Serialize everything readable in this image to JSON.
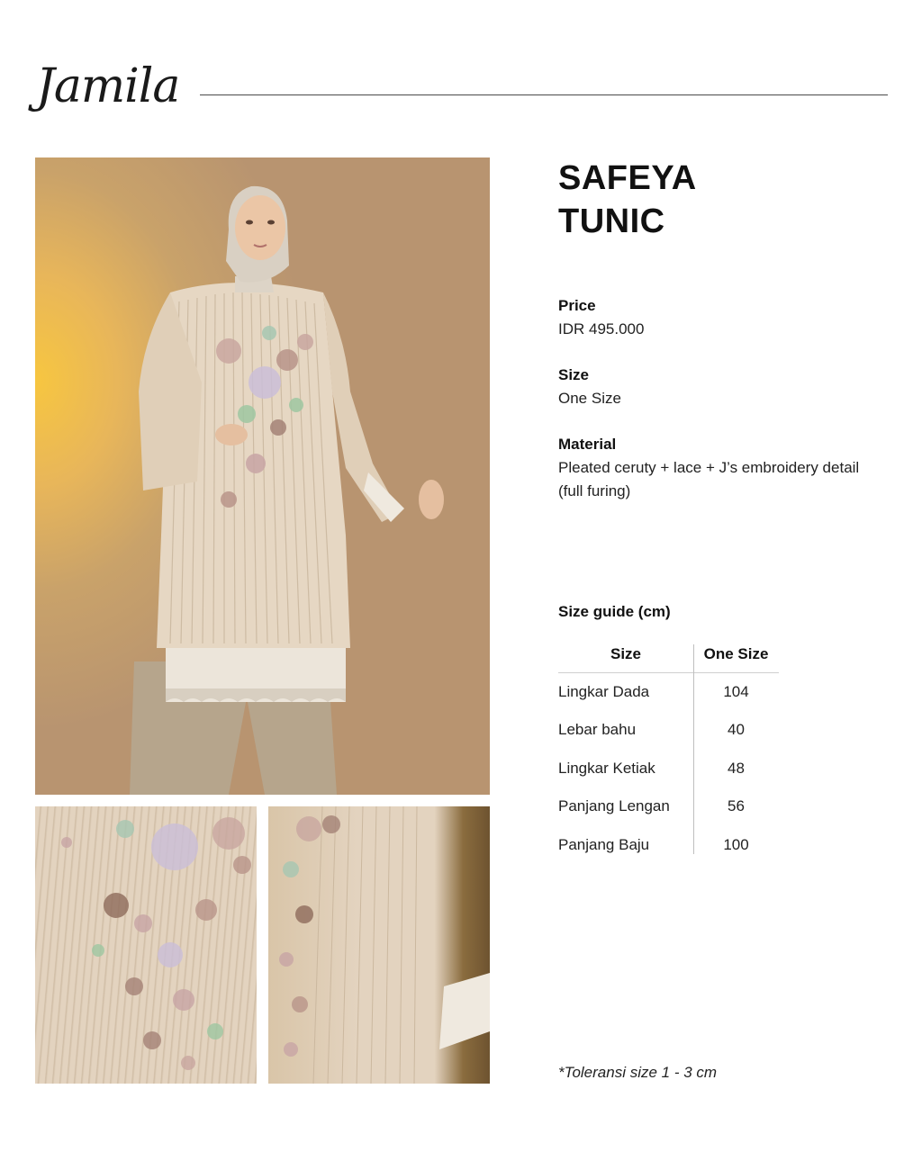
{
  "brand": "Jamila",
  "product": {
    "title_line1": "SAFEYA",
    "title_line2": "TUNIC"
  },
  "details": {
    "price_label": "Price",
    "price_value": "IDR 495.000",
    "size_label": "Size",
    "size_value": "One Size",
    "material_label": "Material",
    "material_value_line1": "Pleated ceruty + lace + J’s embroidery detail",
    "material_value_line2": "(full furing)"
  },
  "size_guide": {
    "title": "Size guide (cm)",
    "headers": [
      "Size",
      "One Size"
    ],
    "rows": [
      {
        "name": "Lingkar Dada",
        "value": "104"
      },
      {
        "name": "Lebar bahu",
        "value": "40"
      },
      {
        "name": "Lingkar Ketiak",
        "value": "48"
      },
      {
        "name": "Panjang Lengan",
        "value": "56"
      },
      {
        "name": "Panjang Baju",
        "value": "100"
      }
    ]
  },
  "note": "*Toleransi size 1 - 3 cm",
  "colors": {
    "backdrop_warm": "#f7c640",
    "fabric": "#e3d3bf",
    "text": "#111111"
  }
}
